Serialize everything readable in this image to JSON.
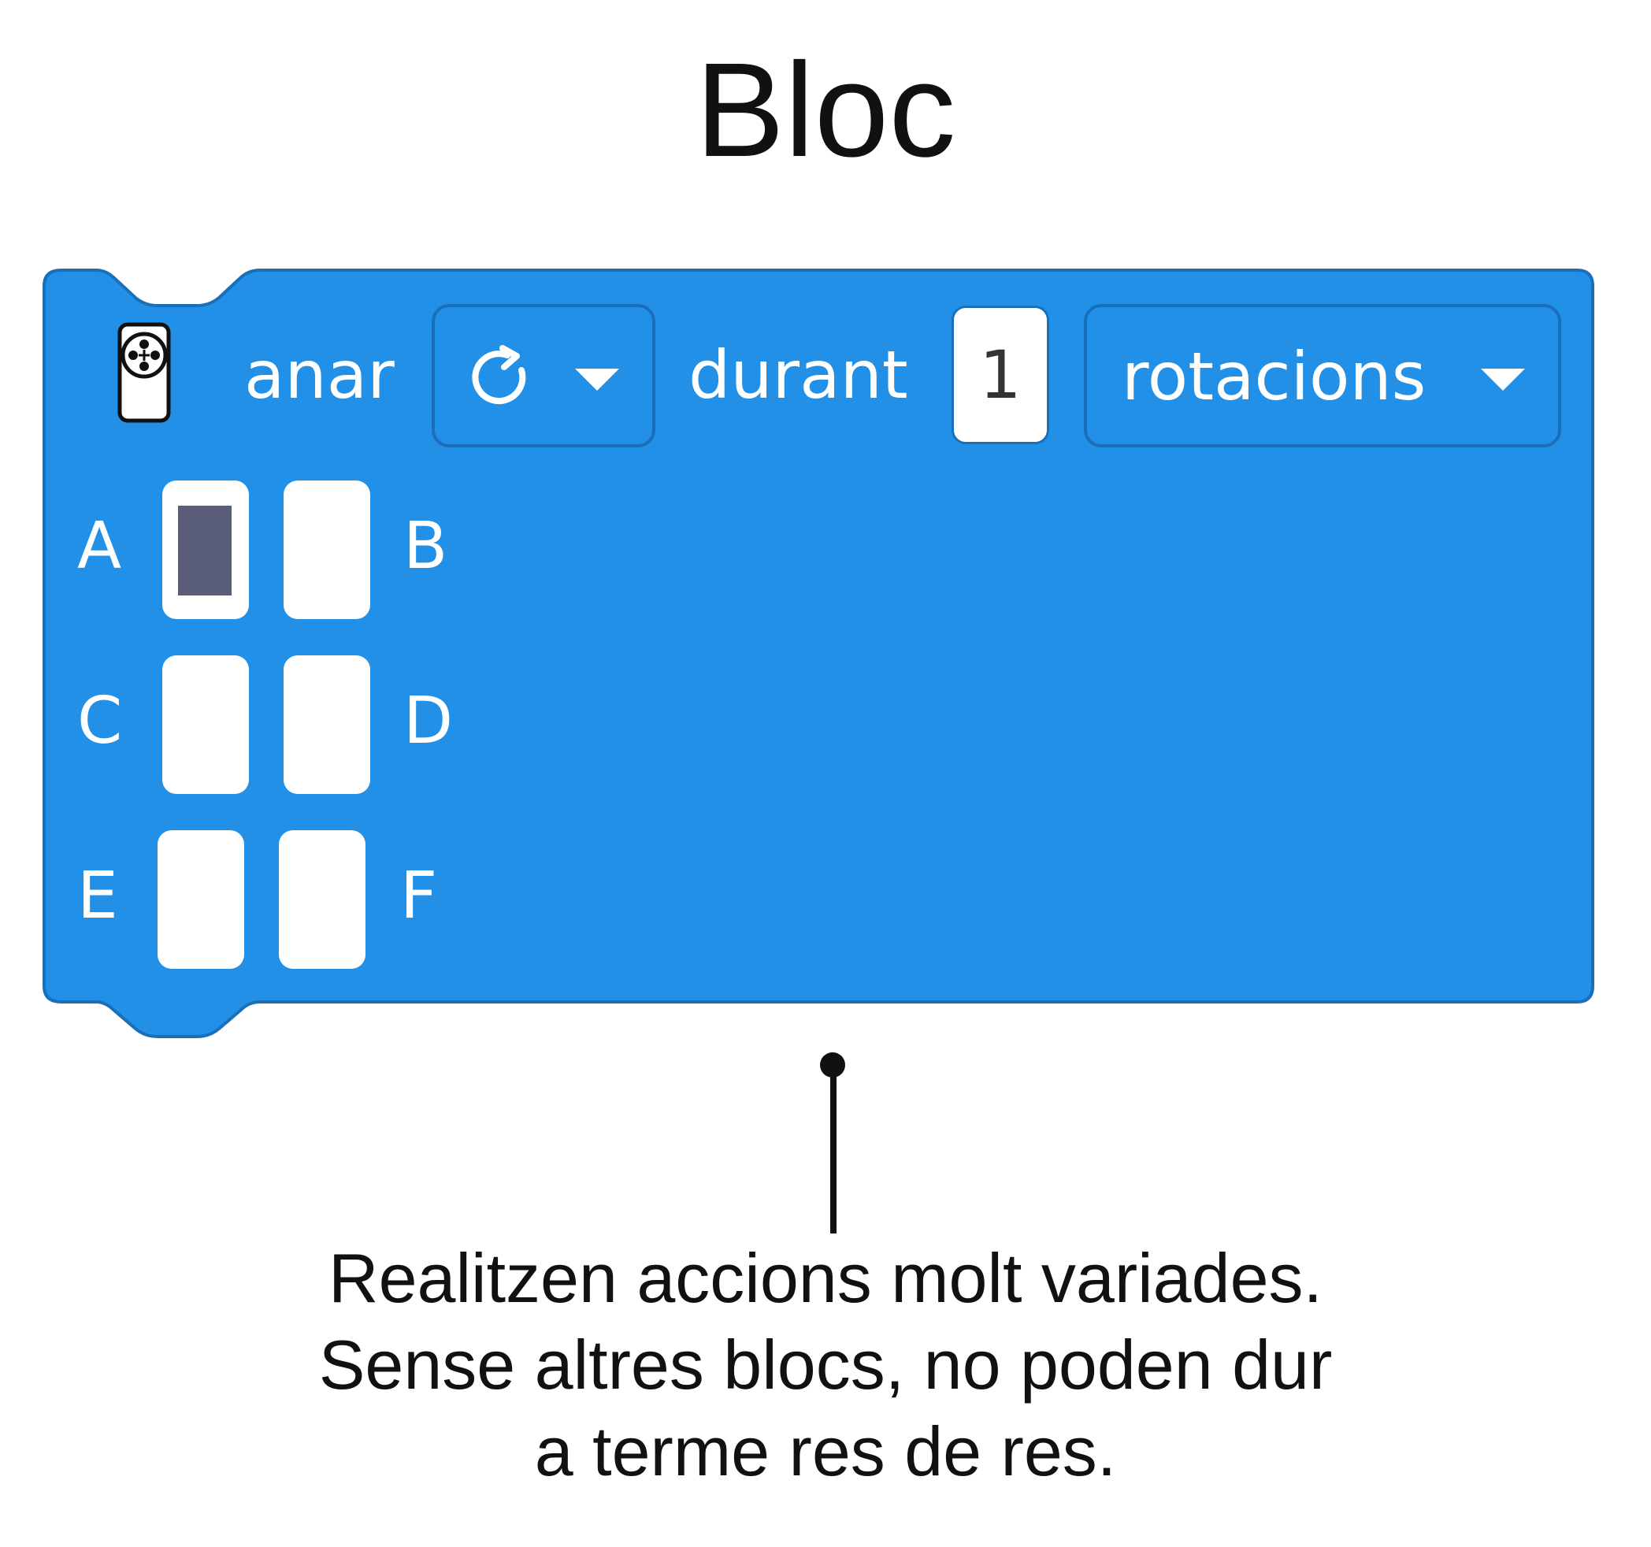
{
  "title": "Bloc",
  "block": {
    "color": "#2290e6",
    "border_color": "#1a70b8",
    "icon": "hub-icon",
    "verb_label": "anar",
    "direction_dropdown": {
      "icon": "rotate-clockwise-icon",
      "caret": "chevron-down-icon"
    },
    "duration_label": "durant",
    "amount_value": "1",
    "unit_dropdown": {
      "label": "rotacions",
      "caret": "chevron-down-icon"
    },
    "ports": [
      {
        "label": "A",
        "selected": true
      },
      {
        "label": "B",
        "selected": false
      },
      {
        "label": "C",
        "selected": false
      },
      {
        "label": "D",
        "selected": false
      },
      {
        "label": "E",
        "selected": false
      },
      {
        "label": "F",
        "selected": false
      }
    ]
  },
  "description": {
    "lines": [
      "Realitzen accions molt variades.",
      "Sense altres blocs, no poden dur",
      "a terme res de res."
    ]
  }
}
